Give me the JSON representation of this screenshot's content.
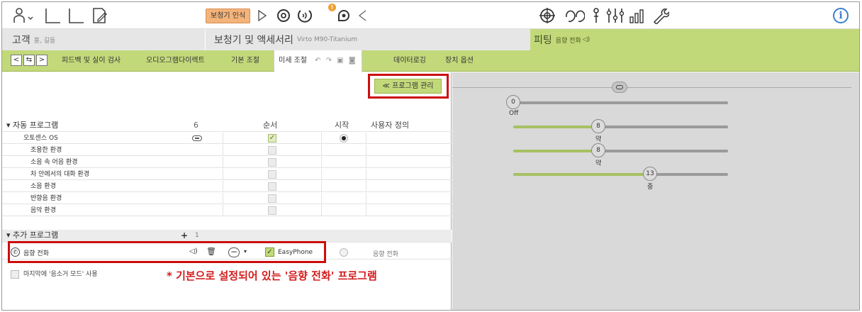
{
  "toolbar": {
    "hearing_aid_detect": "보청기 인식",
    "warning_badge": "!",
    "info": "i"
  },
  "header": {
    "customer_title": "고객",
    "customer_name": "홍, 길동",
    "devices_title": "보청기 및 액세서리",
    "device_model": "Virto M90-Titanium",
    "fitting_title": "피팅",
    "fitting_program": "음향 전화"
  },
  "tabs": [
    "피드백 및 실이 검사",
    "오디오그램다이렉트",
    "기본 조절",
    "미세 조절",
    "데이터로깅",
    "장치 옵션"
  ],
  "program_manage_button": "≪ 프로그램 관리",
  "columns": {
    "count": "6",
    "order": "순서",
    "start": "시작",
    "custom": "사용자 정의"
  },
  "auto_section": "자동 프로그램",
  "auto_programs": [
    {
      "name": "오토센스 OS",
      "checked": true,
      "start": true
    },
    {
      "name": "조용한 환경",
      "checked": false
    },
    {
      "name": "소음 속 어음 환경",
      "checked": false
    },
    {
      "name": "차 안에서의 대화 환경",
      "checked": false
    },
    {
      "name": "소음 환경",
      "checked": false
    },
    {
      "name": "반향음 환경",
      "checked": false
    },
    {
      "name": "음악 환경",
      "checked": false
    }
  ],
  "added_section": "추가 프로그램",
  "added_plus": "+",
  "added_count": "1",
  "phone_program": {
    "name": "음향 전화",
    "easyphone": "EasyPhone",
    "custom": "음향 전화"
  },
  "mute_mode_label": "마지막에 '음소거 모드' 사용",
  "annotation": "* 기본으로 설정되어 있는 '음향 전화' 프로그램",
  "sliders": [
    {
      "value": "0",
      "label": "Off",
      "fraction": 0
    },
    {
      "value": "8",
      "label": "약",
      "fraction": 0.4
    },
    {
      "value": "8",
      "label": "약",
      "fraction": 0.4
    },
    {
      "value": "13",
      "label": "중",
      "fraction": 0.65
    }
  ],
  "colors": {
    "accent_green": "#c2d97a",
    "annotation_red": "#cc0d0d",
    "detect_orange": "#f3b37a"
  }
}
